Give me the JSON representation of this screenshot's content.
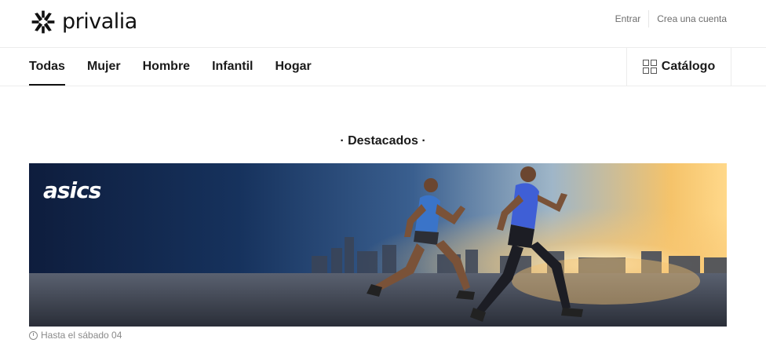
{
  "brand": {
    "logo_text": "privalia"
  },
  "account": {
    "login": "Entrar",
    "register": "Crea una cuenta"
  },
  "nav": {
    "items": [
      {
        "label": "Todas",
        "active": true
      },
      {
        "label": "Mujer"
      },
      {
        "label": "Hombre"
      },
      {
        "label": "Infantil"
      },
      {
        "label": "Hogar"
      }
    ],
    "catalog_label": "Catálogo"
  },
  "featured": {
    "title": "· Destacados ·",
    "banner": {
      "brand_name": "asics"
    },
    "deadline": "Hasta el sábado 04"
  }
}
